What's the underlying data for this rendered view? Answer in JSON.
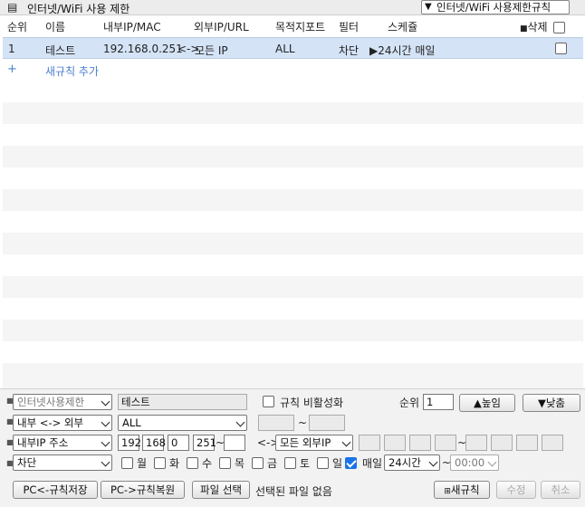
{
  "header": {
    "title": "인터넷/WiFi 사용 제한",
    "rule_select_value": "인터넷/WiFi 사용제한규칙"
  },
  "table": {
    "columns": [
      "순위",
      "이름",
      "내부IP/MAC",
      "외부IP/URL",
      "목적지포트",
      "필터",
      "스케쥴",
      "삭제"
    ],
    "rows": [
      {
        "rank": "1",
        "name": "테스트",
        "internal": "192.168.0.251",
        "arrow": "<->",
        "external": "모든 IP",
        "port": "ALL",
        "filter": "차단",
        "schedule": "▶24시간 매일"
      }
    ],
    "add_rule": "새규칙 추가"
  },
  "form": {
    "type_select": "인터넷사용제한",
    "name_value": "테스트",
    "disable_label": "규칙 비활성화",
    "rank_label": "순위",
    "rank_value": "1",
    "up_button": "▲높임",
    "down_button": "▼낮춤",
    "direction_select": "내부 <-> 외부",
    "protocol_select": "ALL",
    "port_tilde": "~",
    "internal_type_select": "내부IP 주소",
    "ip1": "192",
    "ip2": "168",
    "ip3": "0",
    "ip4": "251",
    "ip_tilde": "~",
    "bidir": "<->",
    "external_type_select": "모든 외부IP",
    "mac_tilde": "~",
    "action_select": "차단",
    "days": [
      "월",
      "화",
      "수",
      "목",
      "금",
      "토",
      "일"
    ],
    "everyday_label": "매일",
    "hours_select": "24시간",
    "time_tilde": "~",
    "time_select": "00:00"
  },
  "actions": {
    "save_to_pc": "PC<-규칙저장",
    "restore_from_pc": "PC->규칙복원",
    "choose_file": "파일 선택",
    "no_file": "선택된 파일 없음",
    "new_rule": "새규칙",
    "modify": "수정",
    "cancel": "취소"
  }
}
